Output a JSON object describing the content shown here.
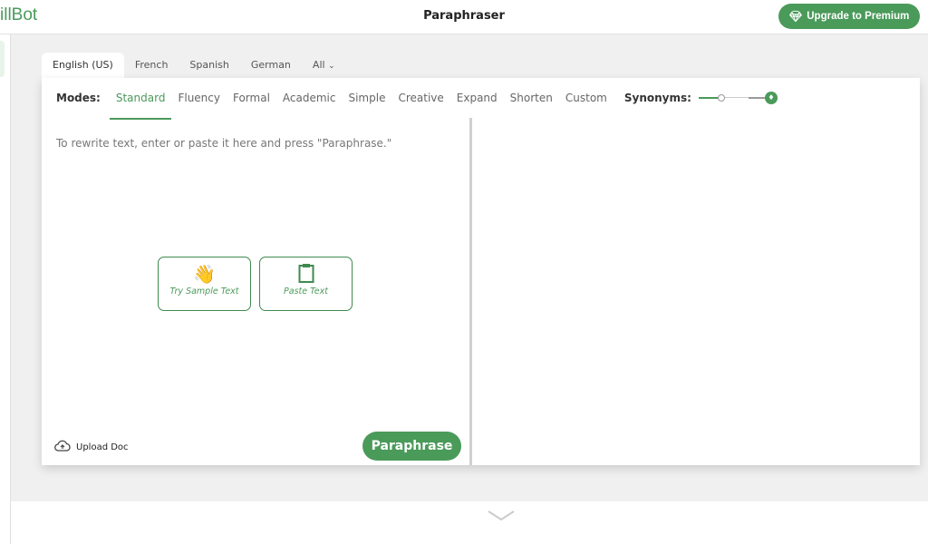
{
  "header": {
    "logo": "illBot",
    "title": "Paraphraser",
    "upgrade_label": "Upgrade to Premium"
  },
  "languages": [
    "English (US)",
    "French",
    "Spanish",
    "German",
    "All"
  ],
  "modes": {
    "label": "Modes:",
    "items": [
      "Standard",
      "Fluency",
      "Formal",
      "Academic",
      "Simple",
      "Creative",
      "Expand",
      "Shorten",
      "Custom"
    ],
    "synonyms_label": "Synonyms:",
    "synonyms_level": 0.33
  },
  "editor": {
    "placeholder": "To rewrite text, enter or paste it here and press \"Paraphrase.\"",
    "sample_label": "Try Sample Text",
    "paste_label": "Paste Text",
    "upload_label": "Upload Doc",
    "paraphrase_label": "Paraphrase"
  },
  "colors": {
    "accent": "#4a9a5a",
    "background": "#f0f0f0"
  }
}
